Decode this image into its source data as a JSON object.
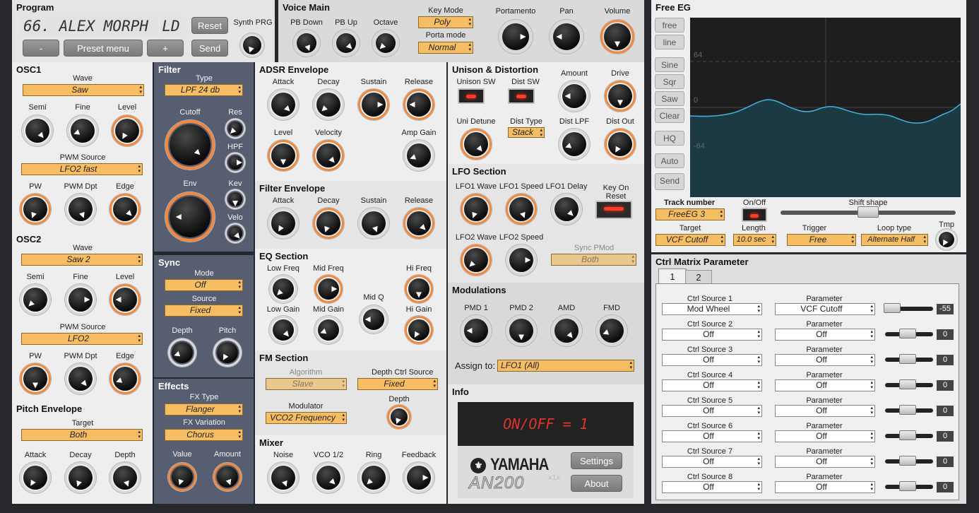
{
  "program": {
    "title": "Program",
    "display": "66. ALEX MORPH",
    "bank": "LD",
    "reset": "Reset",
    "synth_prg": "Synth PRG",
    "minus": "-",
    "preset_menu": "Preset menu",
    "plus": "+",
    "send": "Send"
  },
  "voice_main": {
    "title": "Voice Main",
    "pb_down": "PB Down",
    "pb_up": "PB Up",
    "octave": "Octave",
    "key_mode_label": "Key Mode",
    "key_mode": "Poly",
    "porta_mode_label": "Porta mode",
    "porta_mode": "Normal",
    "portamento": "Portamento",
    "pan": "Pan",
    "volume": "Volume"
  },
  "osc1": {
    "title": "OSC1",
    "wave_label": "Wave",
    "wave": "Saw",
    "semi": "Semi",
    "fine": "Fine",
    "level": "Level",
    "pwm_source_label": "PWM Source",
    "pwm_source": "LFO2 fast",
    "pw": "PW",
    "pwm_dpt": "PWM Dpt",
    "edge": "Edge"
  },
  "osc2": {
    "title": "OSC2",
    "wave_label": "Wave",
    "wave": "Saw 2",
    "semi": "Semi",
    "fine": "Fine",
    "level": "Level",
    "pwm_source_label": "PWM Source",
    "pwm_source": "LFO2",
    "pw": "PW",
    "pwm_dpt": "PWM Dpt",
    "edge": "Edge"
  },
  "pitch_env": {
    "title": "Pitch Envelope",
    "target_label": "Target",
    "target": "Both",
    "attack": "Attack",
    "decay": "Decay",
    "depth": "Depth"
  },
  "filter": {
    "title": "Filter",
    "type_label": "Type",
    "type": "LPF 24 db",
    "cutoff": "Cutoff",
    "res": "Res",
    "hpf": "HPF",
    "env": "Env",
    "kev": "Kev",
    "velo": "Velo"
  },
  "sync": {
    "title": "Sync",
    "mode_label": "Mode",
    "mode": "Off",
    "source_label": "Source",
    "source": "Fixed",
    "depth": "Depth",
    "pitch": "Pitch"
  },
  "effects": {
    "title": "Effects",
    "fx_type_label": "FX Type",
    "fx_type": "Flanger",
    "fx_var_label": "FX Variation",
    "fx_var": "Chorus",
    "value": "Value",
    "amount": "Amount"
  },
  "adsr": {
    "title": "ADSR Envelope",
    "attack": "Attack",
    "decay": "Decay",
    "sustain": "Sustain",
    "release": "Release",
    "level": "Level",
    "velocity": "Velocity",
    "amp_gain": "Amp Gain"
  },
  "fenv": {
    "title": "Filter Envelope",
    "attack": "Attack",
    "decay": "Decay",
    "sustain": "Sustain",
    "release": "Release"
  },
  "eq": {
    "title": "EQ Section",
    "low_freq": "Low Freq",
    "mid_freq": "Mid Freq",
    "mid_q": "Mid Q",
    "hi_freq": "Hi Freq",
    "low_gain": "Low Gain",
    "mid_gain": "Mid Gain",
    "hi_gain": "Hi Gain"
  },
  "fm": {
    "title": "FM Section",
    "algorithm_label": "Algorithm",
    "algorithm": "Slave",
    "depth_src_label": "Depth Ctrl Source",
    "depth_src": "Fixed",
    "modulator_label": "Modulator",
    "modulator": "VCO2 Frequency",
    "depth": "Depth"
  },
  "mixer": {
    "title": "Mixer",
    "noise": "Noise",
    "vco12": "VCO 1/2",
    "ring": "Ring",
    "feedback": "Feedback"
  },
  "unison": {
    "title": "Unison & Distortion",
    "unison_sw": "Unison SW",
    "dist_sw": "Dist SW",
    "amount": "Amount",
    "drive": "Drive",
    "uni_detune": "Uni Detune",
    "dist_type_label": "Dist Type",
    "dist_type": "Stack",
    "dist_lpf": "Dist LPF",
    "dist_out": "Dist Out"
  },
  "lfo": {
    "title": "LFO Section",
    "lfo1_wave": "LFO1 Wave",
    "lfo1_speed": "LFO1 Speed",
    "lfo1_delay": "LFO1 Delay",
    "key_on_reset": "Key On Reset",
    "lfo2_wave": "LFO2 Wave",
    "lfo2_speed": "LFO2 Speed",
    "sync_pmod_label": "Sync PMod",
    "sync_pmod": "Both"
  },
  "mods": {
    "title": "Modulations",
    "pmd1": "PMD 1",
    "pmd2": "PMD 2",
    "amd": "AMD",
    "fmd": "FMD",
    "assign_label": "Assign to:",
    "assign": "LFO1 (All)"
  },
  "info": {
    "title": "Info",
    "display": "ON/OFF = 1",
    "brand": "YAMAHA",
    "model": "AN200",
    "x1": "x1x",
    "settings": "Settings",
    "about": "About"
  },
  "free_eg": {
    "title": "Free EG",
    "free": "free",
    "line": "line",
    "sine": "Sine",
    "sqr": "Sqr",
    "saw": "Saw",
    "clear": "Clear",
    "hq": "HQ",
    "auto": "Auto",
    "send": "Send",
    "y_top": "64",
    "y_mid": "0",
    "y_bot": "-64",
    "track_label": "Track number",
    "track": "FreeEG 3",
    "onoff": "On/Off",
    "shift_shape": "Shift shape",
    "target_label": "Target",
    "target": "VCF Cutoff",
    "length_label": "Length",
    "length": "10.0 sec",
    "trigger_label": "Trigger",
    "trigger": "Free",
    "loop_label": "Loop type",
    "loop": "Alternate Half",
    "tmp": "Tmp"
  },
  "matrix": {
    "title": "Ctrl Matrix Parameter",
    "tab1": "1",
    "tab2": "2",
    "param_label": "Parameter",
    "rows": [
      {
        "src_label": "Ctrl Source 1",
        "src": "Mod Wheel",
        "param": "VCF Cutoff",
        "value": "-55"
      },
      {
        "src_label": "Ctrl Source 2",
        "src": "Off",
        "param": "Off",
        "value": "0"
      },
      {
        "src_label": "Ctrl Source 3",
        "src": "Off",
        "param": "Off",
        "value": "0"
      },
      {
        "src_label": "Ctrl Source 4",
        "src": "Off",
        "param": "Off",
        "value": "0"
      },
      {
        "src_label": "Ctrl Source 5",
        "src": "Off",
        "param": "Off",
        "value": "0"
      },
      {
        "src_label": "Ctrl Source 6",
        "src": "Off",
        "param": "Off",
        "value": "0"
      },
      {
        "src_label": "Ctrl Source 7",
        "src": "Off",
        "param": "Off",
        "value": "0"
      },
      {
        "src_label": "Ctrl Source 8",
        "src": "Off",
        "param": "Off",
        "value": "0"
      }
    ]
  }
}
